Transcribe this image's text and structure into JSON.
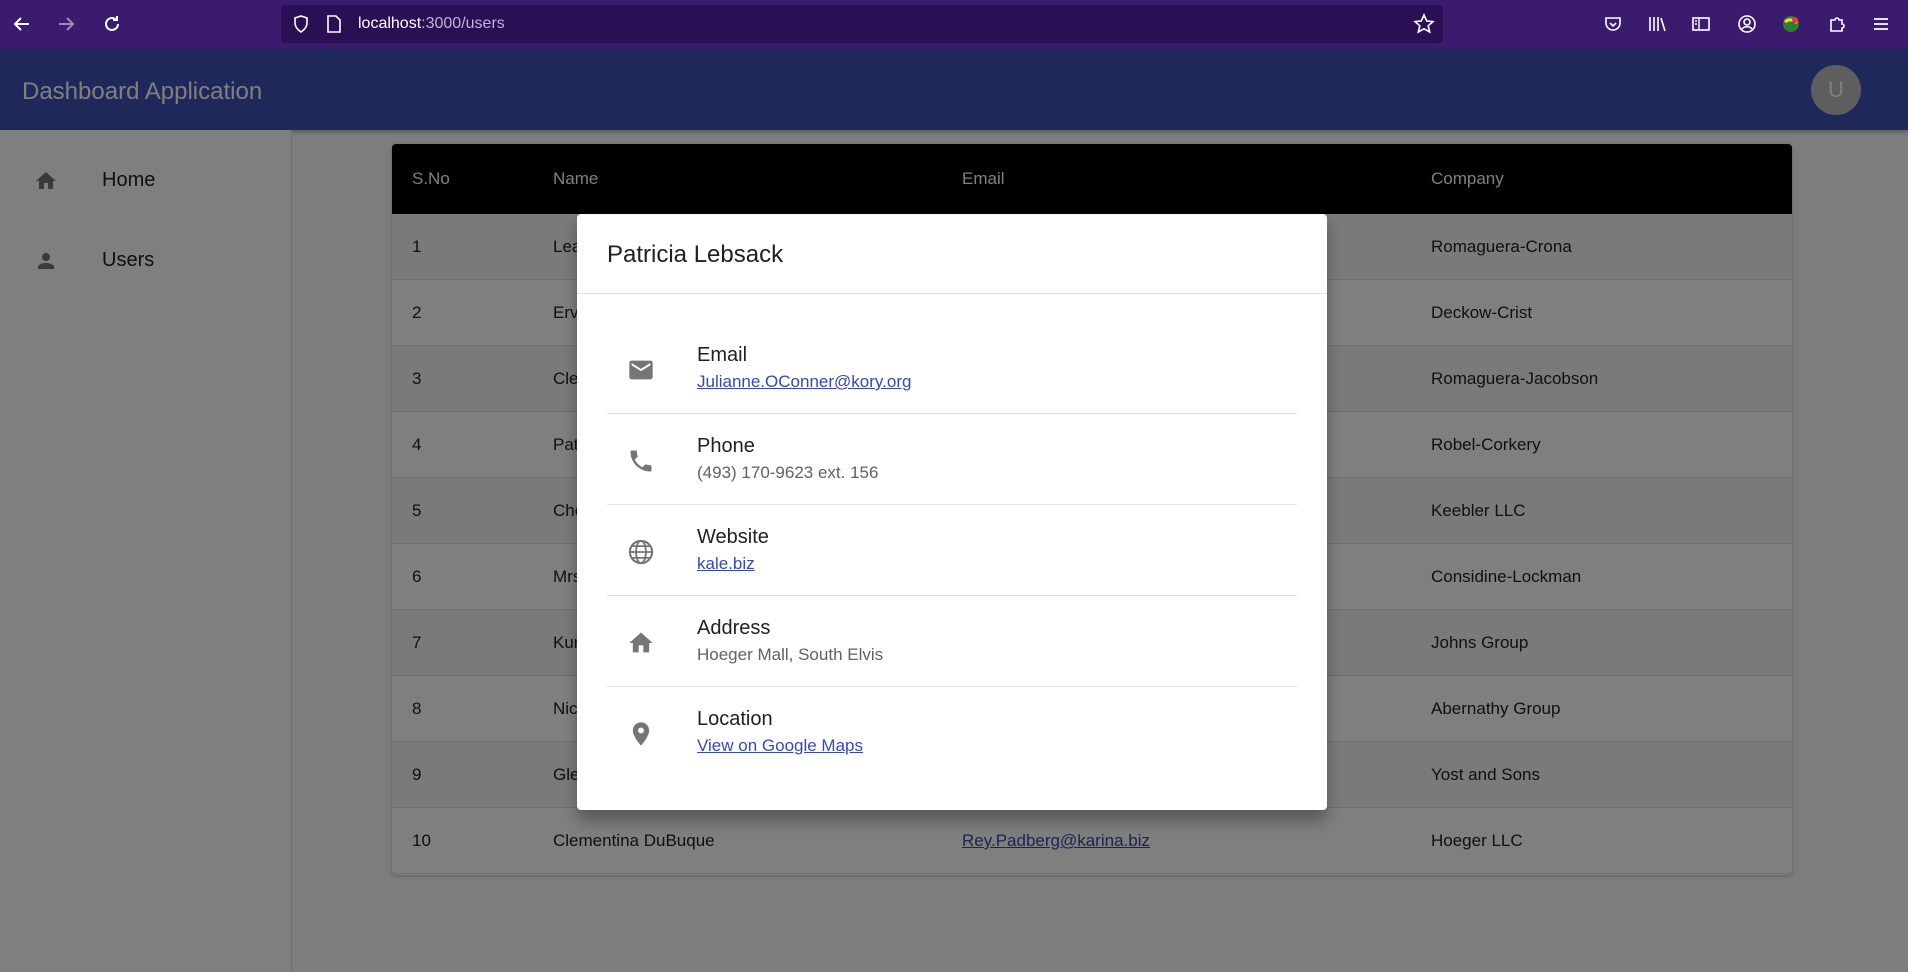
{
  "browser": {
    "url_host": "localhost",
    "url_path": ":3000/users"
  },
  "app": {
    "title": "Dashboard Application",
    "avatar_letter": "U"
  },
  "sidebar": {
    "items": [
      {
        "label": "Home",
        "icon": "home-icon"
      },
      {
        "label": "Users",
        "icon": "person-icon"
      }
    ]
  },
  "table": {
    "headers": [
      "S.No",
      "Name",
      "Email",
      "Company"
    ],
    "rows": [
      {
        "sno": "1",
        "name": "Lea",
        "email": "",
        "company": "Romaguera-Crona"
      },
      {
        "sno": "2",
        "name": "Erv",
        "email": "",
        "company": "Deckow-Crist"
      },
      {
        "sno": "3",
        "name": "Cle",
        "email": "",
        "company": "Romaguera-Jacobson"
      },
      {
        "sno": "4",
        "name": "Pat",
        "email": "",
        "company": "Robel-Corkery"
      },
      {
        "sno": "5",
        "name": "Che",
        "email": "",
        "company": "Keebler LLC"
      },
      {
        "sno": "6",
        "name": "Mrs",
        "email": "",
        "company": "Considine-Lockman"
      },
      {
        "sno": "7",
        "name": "Kur",
        "email": "",
        "company": "Johns Group"
      },
      {
        "sno": "8",
        "name": "Nic",
        "email": "",
        "company": "Abernathy Group"
      },
      {
        "sno": "9",
        "name": "Gle",
        "email": "",
        "company": "Yost and Sons"
      },
      {
        "sno": "10",
        "name": "Clementina DuBuque",
        "email": "Rey.Padberg@karina.biz",
        "company": "Hoeger LLC"
      }
    ]
  },
  "dialog": {
    "title": "Patricia Lebsack",
    "items": [
      {
        "label": "Email",
        "value": "Julianne.OConner@kory.org",
        "icon": "mail-icon",
        "link": true
      },
      {
        "label": "Phone",
        "value": "(493) 170-9623 ext. 156",
        "icon": "phone-icon",
        "link": false
      },
      {
        "label": "Website",
        "value": "kale.biz",
        "icon": "globe-icon",
        "link": true
      },
      {
        "label": "Address",
        "value": "Hoeger Mall, South Elvis",
        "icon": "home-icon",
        "link": false
      },
      {
        "label": "Location",
        "value": "View on Google Maps",
        "icon": "location-pin-icon",
        "link": true
      }
    ]
  },
  "colors": {
    "browser_chrome": "#3b1b6e",
    "appbar": "#3f51b5",
    "link": "#3949ab",
    "table_header": "#000000"
  }
}
